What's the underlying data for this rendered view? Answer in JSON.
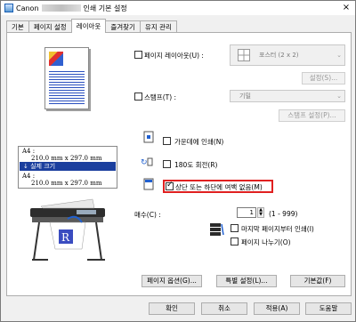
{
  "window": {
    "title_prefix": "Canon",
    "title_suffix": "인쇄 기본 설정",
    "close_glyph": "×"
  },
  "tabs": [
    {
      "label": "기본"
    },
    {
      "label": "페이지 설정"
    },
    {
      "label": "레이아웃"
    },
    {
      "label": "즐겨찾기"
    },
    {
      "label": "유지 관리"
    }
  ],
  "preview": {
    "size_label_top": "A4 :",
    "size_top": "210.0 mm x 297.0 mm",
    "actual_size": "실제 크기",
    "size_label_bottom": "A4 :",
    "size_bottom": "210.0 mm x 297.0 mm"
  },
  "page_layout": {
    "label": "페이지 레이아웃(U) :",
    "value": "포스터 (2 x 2)",
    "settings_button": "설정(S)..."
  },
  "stamp": {
    "label": "스탬프(T) :",
    "value": "기밀",
    "settings_button": "스탬프 설정(P)..."
  },
  "options": {
    "center": "가운데에 인쇄(N)",
    "rotate": "180도 회전(R)",
    "margin": "상단 또는 하단에 여백 없음(M)"
  },
  "copies": {
    "label": "매수(C) :",
    "value": "1",
    "range": "(1 - 999)",
    "last_page_first": "마지막 페이지부터 인쇄(I)",
    "collate": "페이지 나누기(O)"
  },
  "footer_buttons": {
    "page_options": "페이지 옵션(G)...",
    "special_settings": "특별 설정(L)...",
    "defaults": "기본값(F)"
  },
  "dialog_buttons": {
    "ok": "확인",
    "cancel": "취소",
    "apply": "적용(A)",
    "help": "도움말"
  }
}
